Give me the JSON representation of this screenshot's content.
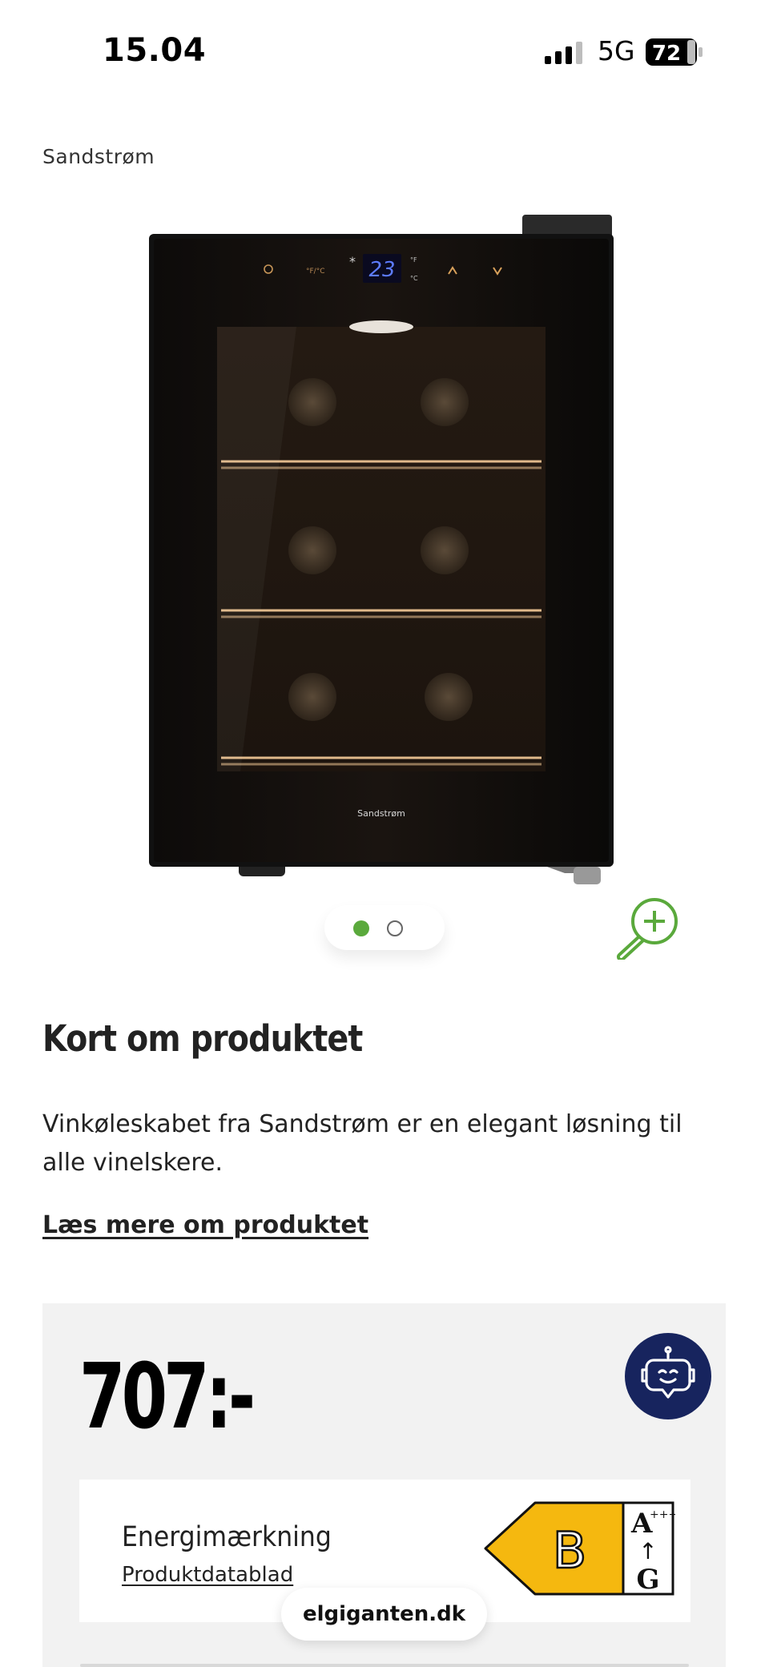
{
  "status_bar": {
    "time": "15.04",
    "network": "5G",
    "battery": "72"
  },
  "product": {
    "brand": "Sandstrøm",
    "image_brand_text": "Sandstrøm",
    "display_temperature": "23",
    "carousel": {
      "total": 2,
      "active_index": 0
    }
  },
  "summary": {
    "title": "Kort om produktet",
    "description": "Vinkøleskabet fra Sandstrøm er en elegant løsning til alle vinelskere.",
    "read_more": "Læs mere om produktet"
  },
  "pricing": {
    "price": "707:-",
    "energy_label_title": "Energimærkning",
    "datasheet_link": "Produktdatablad",
    "energy_class": "B",
    "energy_scale_top": "A",
    "energy_scale_top_plus": "+++",
    "energy_scale_arrow": "↑",
    "energy_scale_bottom": "G",
    "energy_color": "#f5b80f"
  },
  "browser": {
    "url": "elgiganten.dk"
  },
  "colors": {
    "accent_green": "#5aa93c",
    "bot_navy": "#17245e"
  }
}
